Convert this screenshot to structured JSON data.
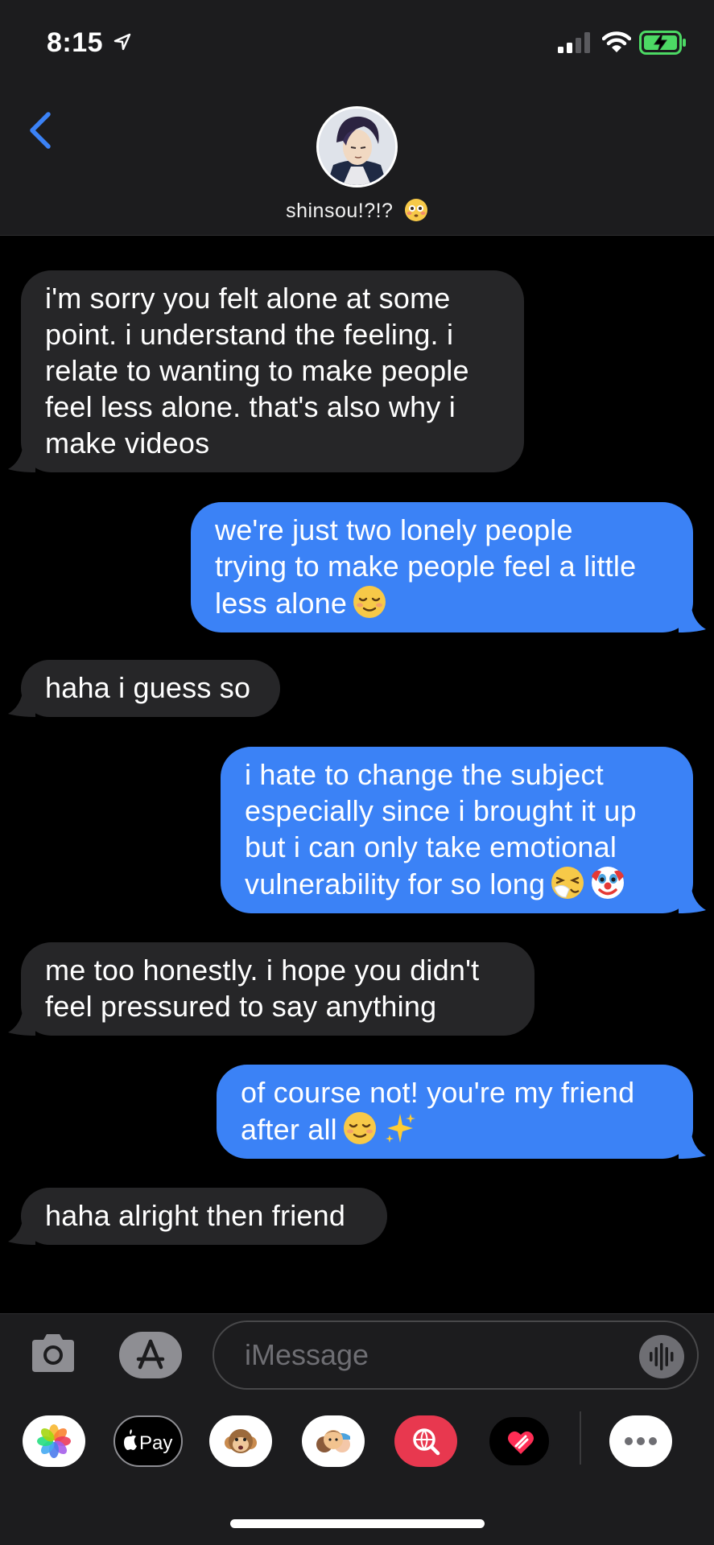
{
  "status_bar": {
    "time": "8:15",
    "icons": [
      "location-arrow-icon",
      "cellular-signal-icon",
      "wifi-icon",
      "battery-charging-icon"
    ]
  },
  "header": {
    "back_icon": "chevron-left-icon",
    "contact_name": "shinsou!?!?",
    "contact_emoji": "flushed-face-emoji"
  },
  "messages": [
    {
      "direction": "incoming",
      "lines": [
        "i'm sorry you felt alone at some",
        "point. i understand the feeling. i",
        "relate to wanting to make people",
        "feel less alone. that's also why i",
        "make videos"
      ]
    },
    {
      "direction": "outgoing",
      "lines": [
        "we're just two lonely people",
        "trying to make people feel a little",
        "less alone"
      ],
      "emoji": [
        "relieved-face-emoji"
      ]
    },
    {
      "direction": "incoming",
      "lines": [
        "haha i guess so"
      ]
    },
    {
      "direction": "outgoing",
      "lines": [
        "i hate to change the subject",
        "especially since i brought it up",
        "but i can only take emotional",
        "vulnerability for so long"
      ],
      "emoji": [
        "sneezing-face-emoji",
        "clown-face-emoji"
      ]
    },
    {
      "direction": "incoming",
      "lines": [
        "me too honestly. i hope you didn't",
        "feel pressured to say anything"
      ]
    },
    {
      "direction": "outgoing",
      "lines": [
        "of course not! you're my friend",
        "after all"
      ],
      "emoji": [
        "relieved-face-emoji",
        "sparkles-emoji"
      ]
    },
    {
      "direction": "incoming",
      "lines": [
        "haha alright then friend"
      ]
    }
  ],
  "composer": {
    "placeholder": "iMessage",
    "camera_icon": "camera-icon",
    "appstore_icon": "app-store-icon",
    "audio_icon": "audio-waveform-icon"
  },
  "app_drawer": {
    "apps": [
      {
        "name": "photos-icon"
      },
      {
        "name": "apple-pay-icon",
        "label": "Pay"
      },
      {
        "name": "animoji-icon"
      },
      {
        "name": "memoji-icon"
      },
      {
        "name": "image-search-icon"
      },
      {
        "name": "digital-touch-icon"
      },
      {
        "name": "more-apps-icon"
      }
    ]
  },
  "colors": {
    "outgoing_bubble": "#3b82f6",
    "incoming_bubble": "#262628",
    "header_bg": "#1c1c1e",
    "accent": "#3b82f6"
  }
}
